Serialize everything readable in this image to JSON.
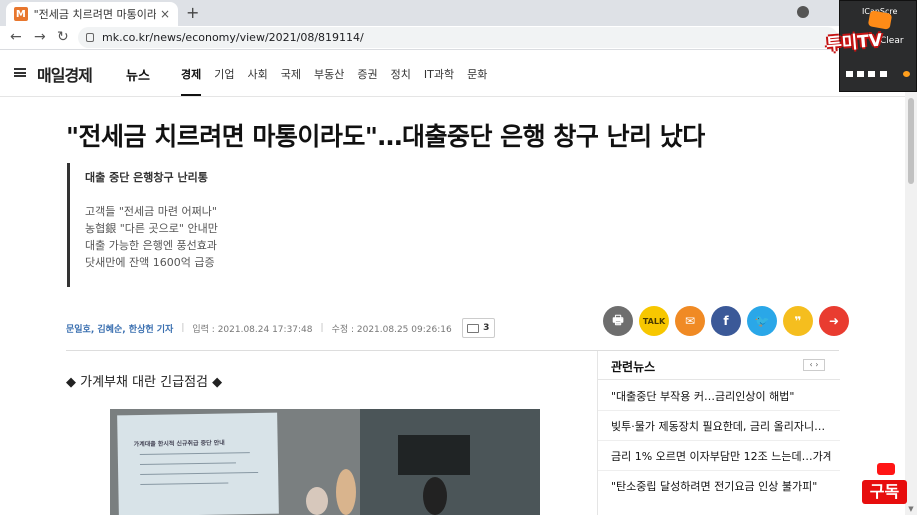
{
  "browser": {
    "tab_title": "\"전세금 치르려면 마통이라도\"…",
    "favicon": "M",
    "url": "mk.co.kr/news/economy/view/2021/08/819114/",
    "tab_close_icon": "close-icon",
    "new_tab_icon": "plus-icon"
  },
  "header": {
    "logo": "매일경제",
    "section": "뉴스",
    "menu": [
      "경제",
      "기업",
      "사회",
      "국제",
      "부동산",
      "증권",
      "정치",
      "IT과학",
      "문화"
    ]
  },
  "article": {
    "headline": "\"전세금 치르려면 마통이라도\"…대출중단 은행 창구 난리 났다",
    "summary": {
      "main": "대출 중단 은행창구 난리통",
      "lines": [
        "고객들 \"전세금 마련 어쩌나\"",
        "농협銀 \"다른 곳으로\" 안내만",
        "",
        "대출 가능한 은행엔 풍선효과",
        "닷새만에 잔액 1600억 급증"
      ]
    },
    "byline": {
      "authors": "문일호, 김혜순, 한상헌 기자",
      "input_label": "입력 : 2021.08.24 17:37:48",
      "modified_label": "수정 : 2021.08.25 09:26:16",
      "comment_count": "3"
    },
    "section_heading": "◆ 가계부채 대란 긴급점검 ◆",
    "photo_notice": "가계대출 한시적 신규취급 중단 안내"
  },
  "share_buttons": [
    {
      "name": "print-button",
      "label": "🖶",
      "color": "#6e6e6e"
    },
    {
      "name": "kakaotalk-button",
      "label": "TALK",
      "color": "#f7c700"
    },
    {
      "name": "email-button",
      "label": "✉",
      "color": "#f08a24"
    },
    {
      "name": "facebook-button",
      "label": "f",
      "color": "#3b5998"
    },
    {
      "name": "twitter-button",
      "label": "🐦",
      "color": "#2aa7e8"
    },
    {
      "name": "kakaostory-button",
      "label": "❞",
      "color": "#f5be1e"
    },
    {
      "name": "share-more-button",
      "label": "➜",
      "color": "#e93c30"
    }
  ],
  "related_news": {
    "title": "관련뉴스",
    "nav": "‹ ›",
    "items": [
      "\"대출중단 부작용 커…금리인상이 해법\"",
      "빚투·물가 제동장치 필요한데, 금리 올리자니…",
      "금리 1% 오르면 이자부담만 12조 느는데…가계…",
      "\"탄소중립 달성하려면 전기요금 인상 불가피\""
    ]
  },
  "recorder": {
    "app_name": "ICanScre",
    "clear_label": "Clear"
  },
  "overlay": {
    "brand": "투미TV",
    "subscribe": "구독"
  }
}
